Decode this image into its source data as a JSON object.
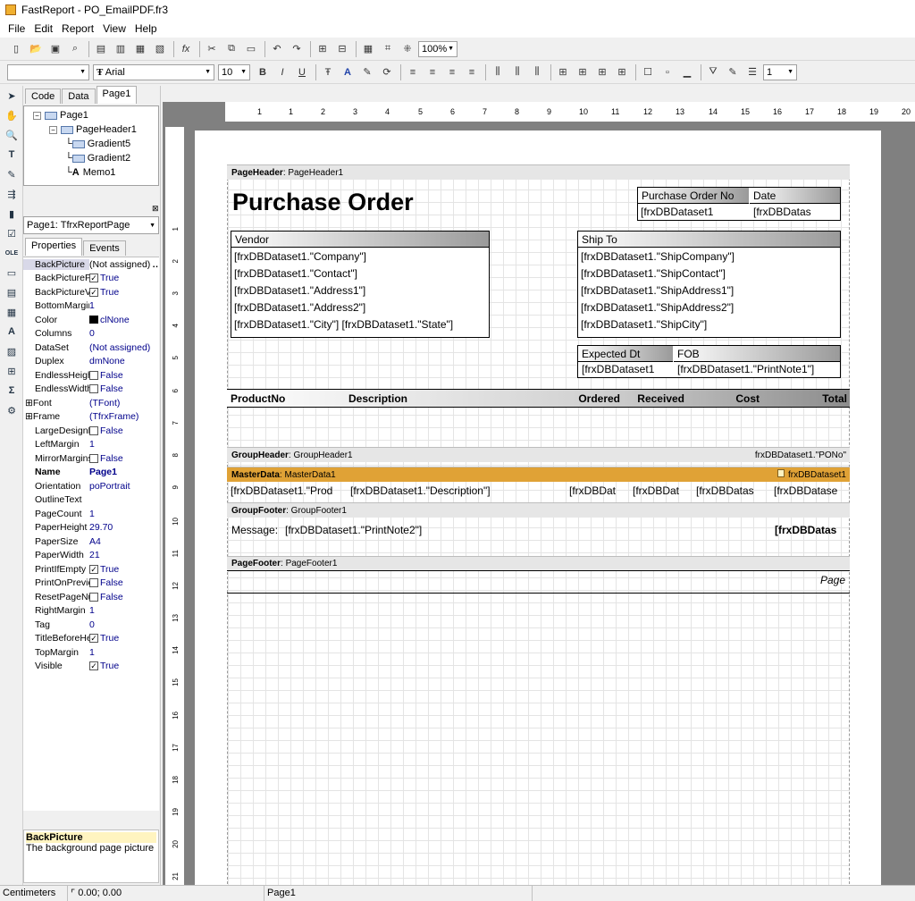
{
  "window": {
    "title": "FastReport - PO_EmailPDF.fr3"
  },
  "menu": [
    "File",
    "Edit",
    "Report",
    "View",
    "Help"
  ],
  "toolbar": {
    "zoom": "100%",
    "font": "Arial",
    "size": "10",
    "line_width": "1"
  },
  "left_tabs": [
    "Code",
    "Data",
    "Page1"
  ],
  "tree": [
    {
      "label": "Page1",
      "level": 0,
      "box": "−"
    },
    {
      "label": "PageHeader1",
      "level": 1,
      "box": "−"
    },
    {
      "label": "Gradient5",
      "level": 2
    },
    {
      "label": "Gradient2",
      "level": 2
    },
    {
      "label": "Memo1",
      "level": 2
    }
  ],
  "object_combo": "Page1: TfrxReportPage",
  "prop_tabs": [
    "Properties",
    "Events"
  ],
  "props": [
    {
      "name": "BackPicture",
      "value": "(Not assigned)",
      "more": true
    },
    {
      "name": "BackPicturePrintable",
      "value": "True",
      "check": true
    },
    {
      "name": "BackPictureVisible",
      "value": "True",
      "check": true
    },
    {
      "name": "BottomMargin",
      "value": "1"
    },
    {
      "name": "Color",
      "value": "clNone",
      "swatch": true
    },
    {
      "name": "Columns",
      "value": "0"
    },
    {
      "name": "DataSet",
      "value": "(Not assigned)"
    },
    {
      "name": "Duplex",
      "value": "dmNone"
    },
    {
      "name": "EndlessHeight",
      "value": "False",
      "check": false
    },
    {
      "name": "EndlessWidth",
      "value": "False",
      "check": false
    },
    {
      "name": "Font",
      "value": "(TFont)",
      "plus": true
    },
    {
      "name": "Frame",
      "value": "(TfrxFrame)",
      "plus": true
    },
    {
      "name": "LargeDesignHeight",
      "value": "False",
      "check": false
    },
    {
      "name": "LeftMargin",
      "value": "1"
    },
    {
      "name": "MirrorMargins",
      "value": "False",
      "check": false
    },
    {
      "name": "Name",
      "value": "Page1",
      "bold": true
    },
    {
      "name": "Orientation",
      "value": "poPortrait"
    },
    {
      "name": "OutlineText",
      "value": ""
    },
    {
      "name": "PageCount",
      "value": "1"
    },
    {
      "name": "PaperHeight",
      "value": "29.70"
    },
    {
      "name": "PaperSize",
      "value": "A4"
    },
    {
      "name": "PaperWidth",
      "value": "21"
    },
    {
      "name": "PrintIfEmpty",
      "value": "True",
      "check": true
    },
    {
      "name": "PrintOnPreviousPage",
      "value": "False",
      "check": false
    },
    {
      "name": "ResetPageNumbers",
      "value": "False",
      "check": false
    },
    {
      "name": "RightMargin",
      "value": "1"
    },
    {
      "name": "Tag",
      "value": "0"
    },
    {
      "name": "TitleBeforeHeader",
      "value": "True",
      "check": true
    },
    {
      "name": "TopMargin",
      "value": "1"
    },
    {
      "name": "Visible",
      "value": "True",
      "check": true
    }
  ],
  "hint": {
    "title": "BackPicture",
    "text": "The background page picture"
  },
  "status": {
    "units": "Centimeters",
    "coords": "0.00; 0.00",
    "page": "Page1"
  },
  "ruler_h": [
    "1",
    "1",
    "2",
    "3",
    "4",
    "5",
    "6",
    "7",
    "8",
    "9",
    "10",
    "11",
    "12",
    "13",
    "14",
    "15",
    "16",
    "17",
    "18",
    "19",
    "20"
  ],
  "ruler_v": [
    "1",
    "2",
    "3",
    "4",
    "5",
    "6",
    "7",
    "8",
    "9",
    "10",
    "11",
    "12",
    "13",
    "14",
    "15",
    "16",
    "17",
    "18",
    "19",
    "20",
    "21"
  ],
  "report": {
    "pageheader_band": {
      "type": "PageHeader",
      "name": "PageHeader1"
    },
    "title": "Purchase Order",
    "po_no_label": "Purchase Order No",
    "date_label": "Date",
    "po_no_value": "[frxDBDataset1",
    "date_value": "[frxDBDatas",
    "vendor_label": "Vendor",
    "vendor_lines": [
      "[frxDBDataset1.\"Company\"]",
      "[frxDBDataset1.\"Contact\"]",
      "[frxDBDataset1.\"Address1\"]",
      "[frxDBDataset1.\"Address2\"]",
      "[frxDBDataset1.\"City\"] [frxDBDataset1.\"State\"]"
    ],
    "shipto_label": "Ship To",
    "shipto_lines": [
      "[frxDBDataset1.\"ShipCompany\"]",
      "[frxDBDataset1.\"ShipContact\"]",
      "[frxDBDataset1.\"ShipAddress1\"]",
      "[frxDBDataset1.\"ShipAddress2\"]",
      "[frxDBDataset1.\"ShipCity\"]"
    ],
    "expected_label": "Expected Dt",
    "fob_label": "FOB",
    "expected_value": "[frxDBDataset1",
    "fob_value": "[frxDBDataset1.\"PrintNote1\"]",
    "columns": [
      "ProductNo",
      "Description",
      "Ordered",
      "Received",
      "Cost",
      "Total"
    ],
    "groupheader_band": {
      "type": "GroupHeader",
      "name": "GroupHeader1",
      "condition": "frxDBDataset1.\"PONo\""
    },
    "masterdata_band": {
      "type": "MasterData",
      "name": "MasterData1",
      "dataset": "frxDBDataset1"
    },
    "detail_cells": [
      "[frxDBDataset1.\"Prod",
      "[frxDBDataset1.\"Description\"]",
      "[frxDBDat",
      "[frxDBDat",
      "[frxDBDatas",
      "[frxDBDatase"
    ],
    "groupfooter_band": {
      "type": "GroupFooter",
      "name": "GroupFooter1"
    },
    "message_label": "Message:",
    "message_value": "[frxDBDataset1.\"PrintNote2\"]",
    "footer_total": "[frxDBDatas",
    "pagefooter_band": {
      "type": "PageFooter",
      "name": "PageFooter1"
    },
    "page_text": "Page"
  }
}
